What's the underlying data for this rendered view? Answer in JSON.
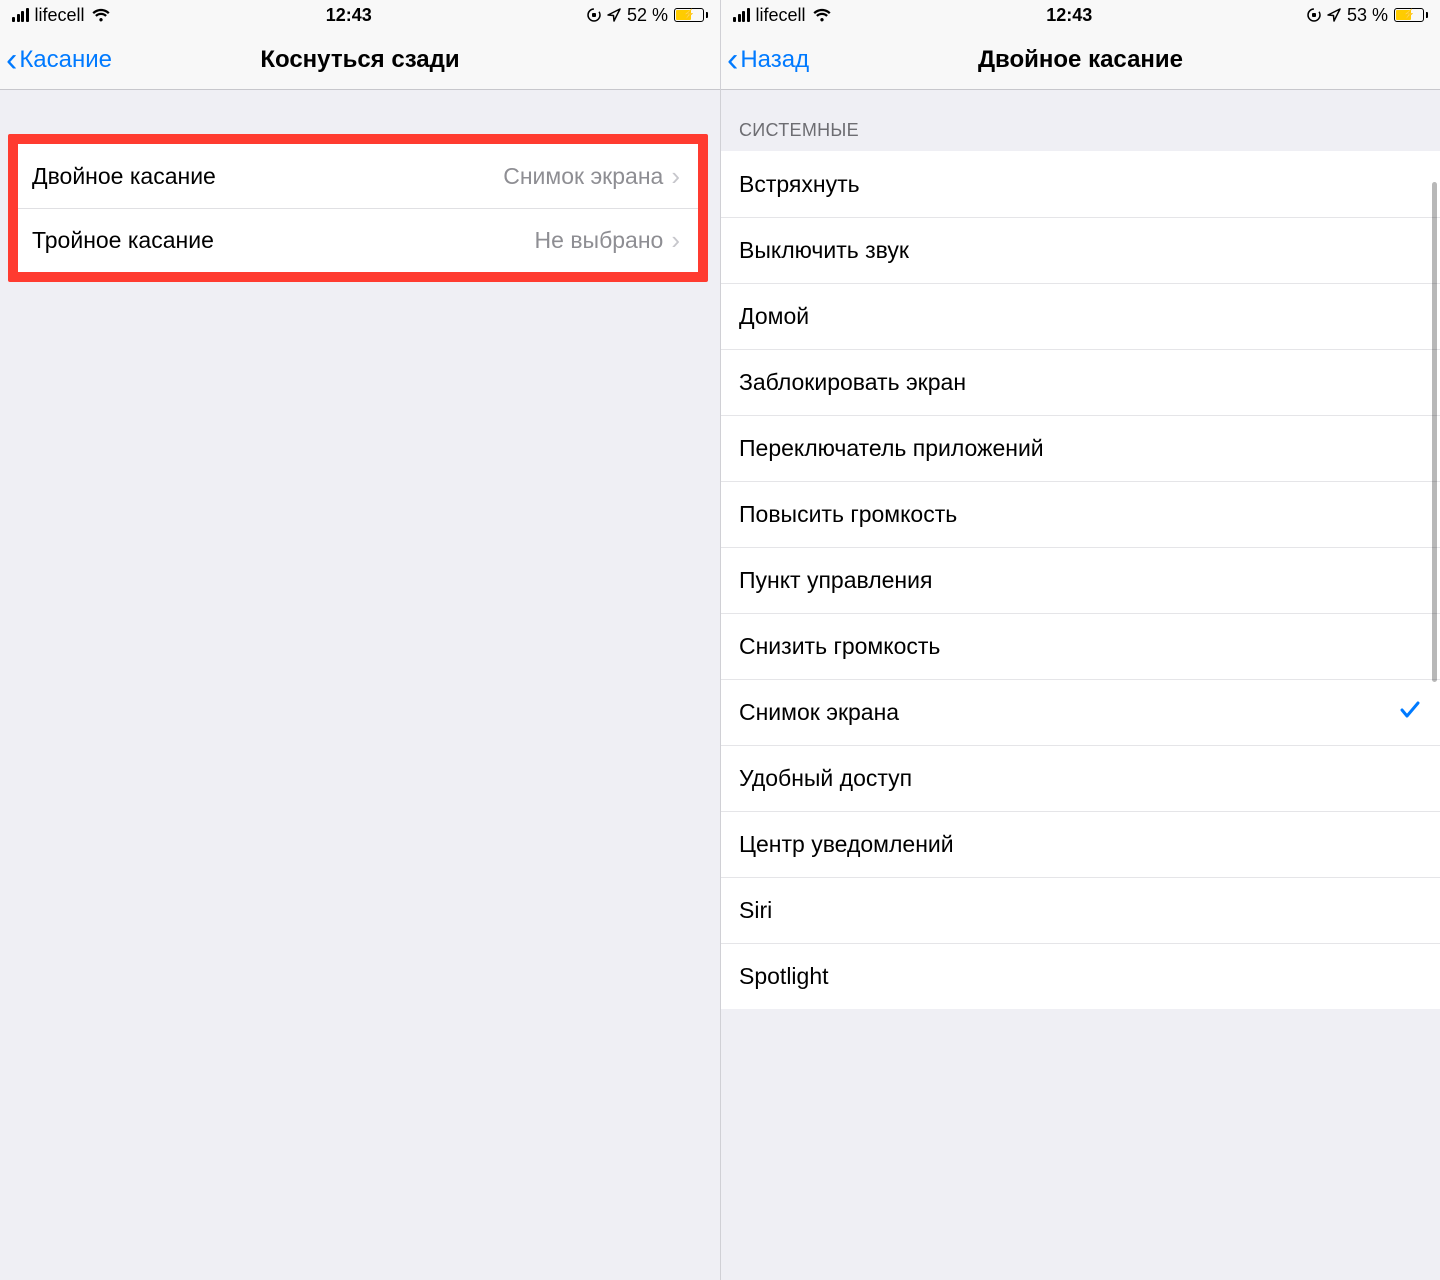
{
  "left": {
    "status": {
      "carrier": "lifecell",
      "time": "12:43",
      "battery_text": "52 %"
    },
    "nav": {
      "back_label": "Касание",
      "title": "Коснуться сзади"
    },
    "rows": [
      {
        "title": "Двойное касание",
        "value": "Снимок экрана"
      },
      {
        "title": "Тройное касание",
        "value": "Не выбрано"
      }
    ]
  },
  "right": {
    "status": {
      "carrier": "lifecell",
      "time": "12:43",
      "battery_text": "53 %"
    },
    "nav": {
      "back_label": "Назад",
      "title": "Двойное касание"
    },
    "section_header": "СИСТЕМНЫЕ",
    "options": [
      {
        "label": "Встряхнуть",
        "selected": false
      },
      {
        "label": "Выключить звук",
        "selected": false
      },
      {
        "label": "Домой",
        "selected": false
      },
      {
        "label": "Заблокировать экран",
        "selected": false
      },
      {
        "label": "Переключатель приложений",
        "selected": false
      },
      {
        "label": "Повысить громкость",
        "selected": false
      },
      {
        "label": "Пункт управления",
        "selected": false
      },
      {
        "label": "Снизить громкость",
        "selected": false
      },
      {
        "label": "Снимок экрана",
        "selected": true
      },
      {
        "label": "Удобный доступ",
        "selected": false
      },
      {
        "label": "Центр уведомлений",
        "selected": false
      },
      {
        "label": "Siri",
        "selected": false
      },
      {
        "label": "Spotlight",
        "selected": false
      }
    ]
  }
}
